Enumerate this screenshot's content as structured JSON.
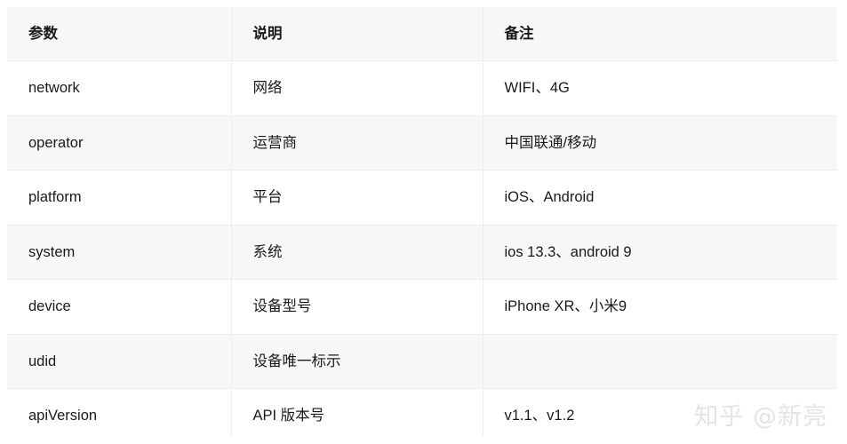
{
  "table": {
    "columns": [
      "参数",
      "说明",
      "备注"
    ],
    "rows": [
      {
        "param": "network",
        "desc": "网络",
        "remark": "WIFI、4G"
      },
      {
        "param": "operator",
        "desc": "运营商",
        "remark": "中国联通/移动"
      },
      {
        "param": "platform",
        "desc": "平台",
        "remark": "iOS、Android"
      },
      {
        "param": "system",
        "desc": "系统",
        "remark": "ios 13.3、android 9"
      },
      {
        "param": "device",
        "desc": "设备型号",
        "remark": "iPhone XR、小米9"
      },
      {
        "param": "udid",
        "desc": "设备唯一标示",
        "remark": ""
      },
      {
        "param": "apiVersion",
        "desc": "API 版本号",
        "remark": "v1.1、v1.2"
      }
    ]
  },
  "watermark": {
    "text": "知乎 @新亮",
    "color": "#e2e4e6"
  },
  "colors": {
    "header_background": "#f7f7f8",
    "row_stripe": "#f7f7f8",
    "row_base": "#ffffff",
    "border": "#ececee",
    "text": "#1a1a1a"
  }
}
